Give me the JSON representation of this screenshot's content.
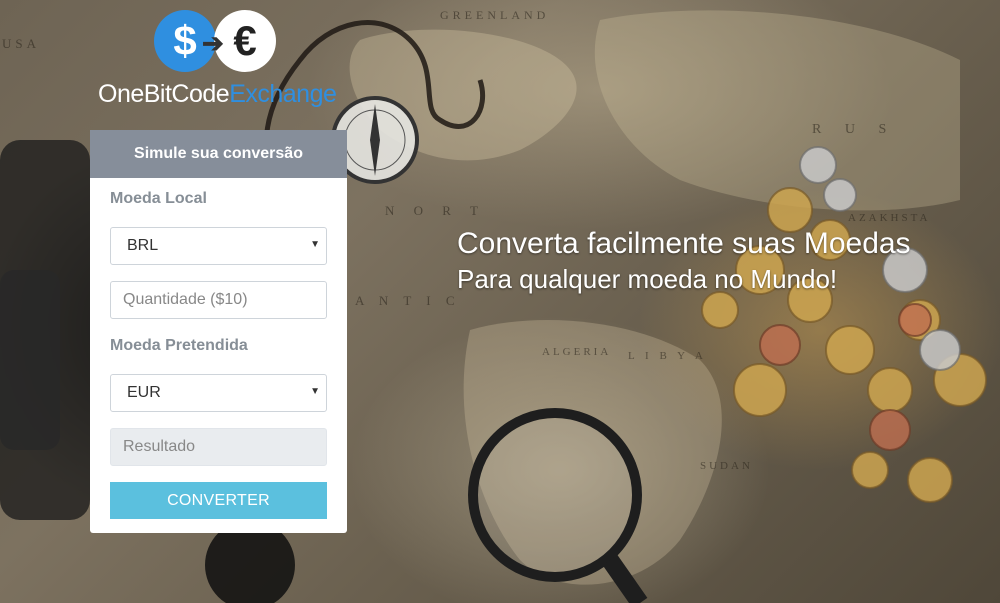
{
  "logo": {
    "dollar_glyph": "$",
    "euro_glyph": "€",
    "arrow_glyph": "➔",
    "brand_part1": "OneBitCode",
    "brand_part2": "Exchange",
    "accent_color": "#2f8fe0"
  },
  "form": {
    "title": "Simule sua conversão",
    "local_currency_label": "Moeda Local",
    "local_currency_value": "BRL",
    "quantity_placeholder": "Quantidade ($10)",
    "target_currency_label": "Moeda Pretendida",
    "target_currency_value": "EUR",
    "result_placeholder": "Resultado",
    "convert_button": "CONVERTER",
    "button_color": "#5bc0de",
    "header_color": "#868e9a"
  },
  "hero": {
    "line1": "Converta facilmente suas Moedas",
    "line2": "Para qualquer moeda no Mundo!"
  },
  "map_labels": [
    "GREENLAND",
    "USA",
    "R U S",
    "N O R T",
    "A N T I C",
    "ALGERIA",
    "L I B Y A",
    "SUDAN",
    "AZAKHSTA"
  ]
}
